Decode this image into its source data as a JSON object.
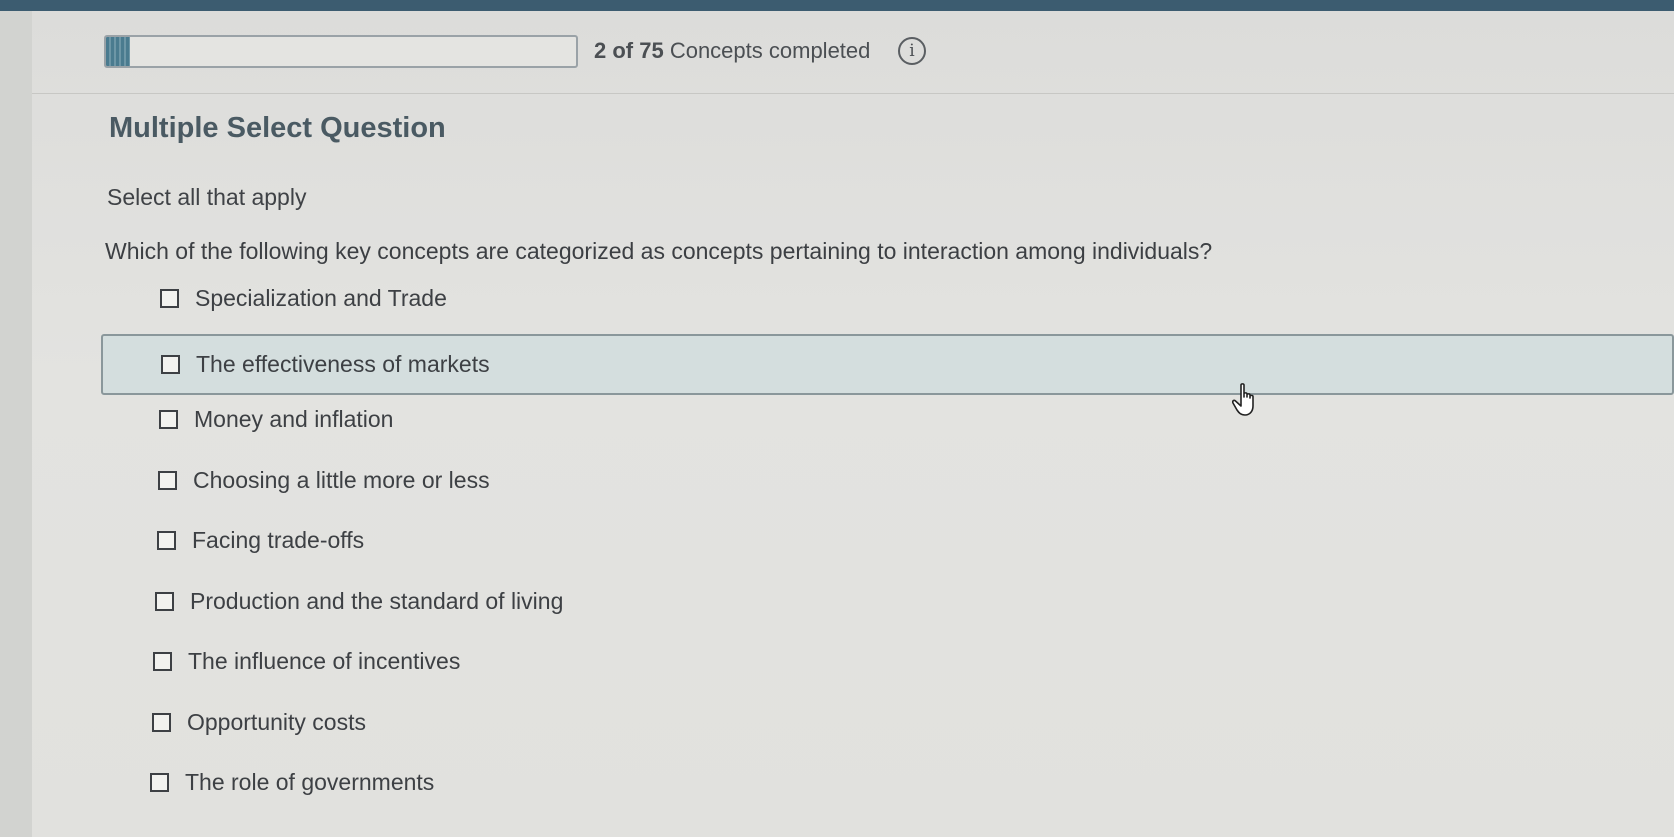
{
  "progress": {
    "completed": 2,
    "total": 75,
    "fraction": 0.027,
    "count_label": "2 of 75",
    "suffix_label": "Concepts completed",
    "info_icon": "i"
  },
  "question": {
    "type_label": "Multiple Select Question",
    "instruction": "Select all that apply",
    "prompt": "Which of the following key concepts are categorized as concepts pertaining to interaction among individuals?",
    "options": [
      {
        "label": "Specialization and Trade",
        "checked": false
      },
      {
        "label": "The effectiveness of markets",
        "checked": false,
        "hovered": true
      },
      {
        "label": "Money and inflation",
        "checked": false
      },
      {
        "label": "Choosing a little more or less",
        "checked": false
      },
      {
        "label": "Facing trade-offs",
        "checked": false
      },
      {
        "label": "Production and the standard of living",
        "checked": false
      },
      {
        "label": "The influence of incentives",
        "checked": false
      },
      {
        "label": "Opportunity costs",
        "checked": false
      },
      {
        "label": "The role of governments",
        "checked": false
      }
    ]
  },
  "colors": {
    "accent": "#4a7b8f",
    "hover_bg": "#d4dede",
    "heading": "#4a5a63"
  },
  "icons": {
    "info": "info-icon",
    "cursor": "hand-pointer-icon"
  }
}
